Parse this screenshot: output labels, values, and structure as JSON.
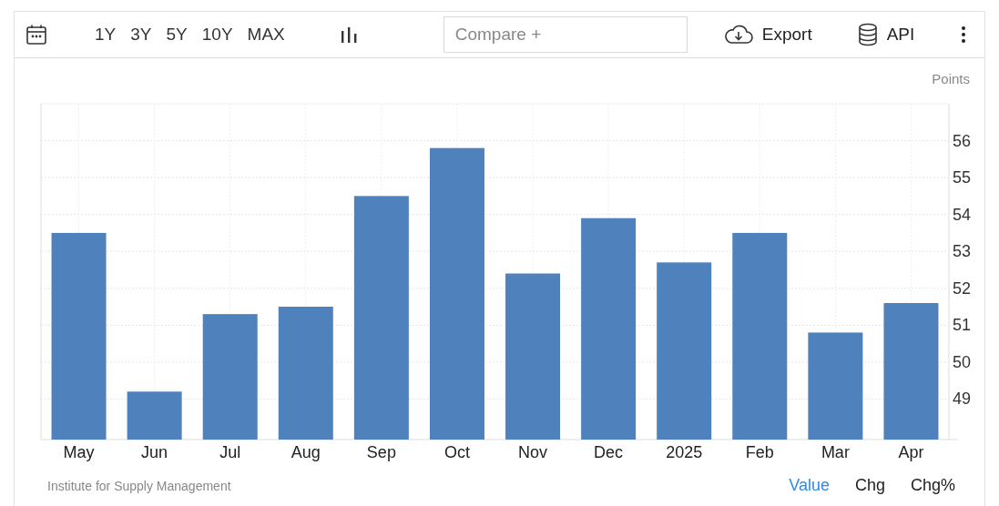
{
  "toolbar": {
    "ranges": [
      {
        "label": "1Y",
        "selected": false
      },
      {
        "label": "3Y",
        "selected": false
      },
      {
        "label": "5Y",
        "selected": false
      },
      {
        "label": "10Y",
        "selected": false
      },
      {
        "label": "MAX",
        "selected": false
      }
    ],
    "compare": {
      "placeholder": "Compare +"
    },
    "export": "Export",
    "api": "API"
  },
  "chart": {
    "unit": "Points",
    "chart_data": {
      "type": "bar",
      "categories": [
        "May",
        "Jun",
        "Jul",
        "Aug",
        "Sep",
        "Oct",
        "Nov",
        "Dec",
        "2025",
        "Feb",
        "Mar",
        "Apr"
      ],
      "grid": true,
      "series": [
        {
          "color": "#4f81bd",
          "values": [
            53.5,
            49.2,
            51.3,
            51.5,
            54.5,
            55.8,
            52.4,
            53.9,
            52.7,
            53.5,
            50.8,
            51.6
          ]
        }
      ],
      "ylim": [
        47.9,
        57
      ],
      "yticks": [
        49,
        50,
        51,
        52,
        53,
        54,
        55,
        56
      ]
    }
  },
  "footer": {
    "source": "Institute for Supply Management",
    "views": [
      {
        "label": "Value",
        "selected": true
      },
      {
        "label": "Chg",
        "selected": false
      },
      {
        "label": "Chg%",
        "selected": false
      }
    ]
  }
}
